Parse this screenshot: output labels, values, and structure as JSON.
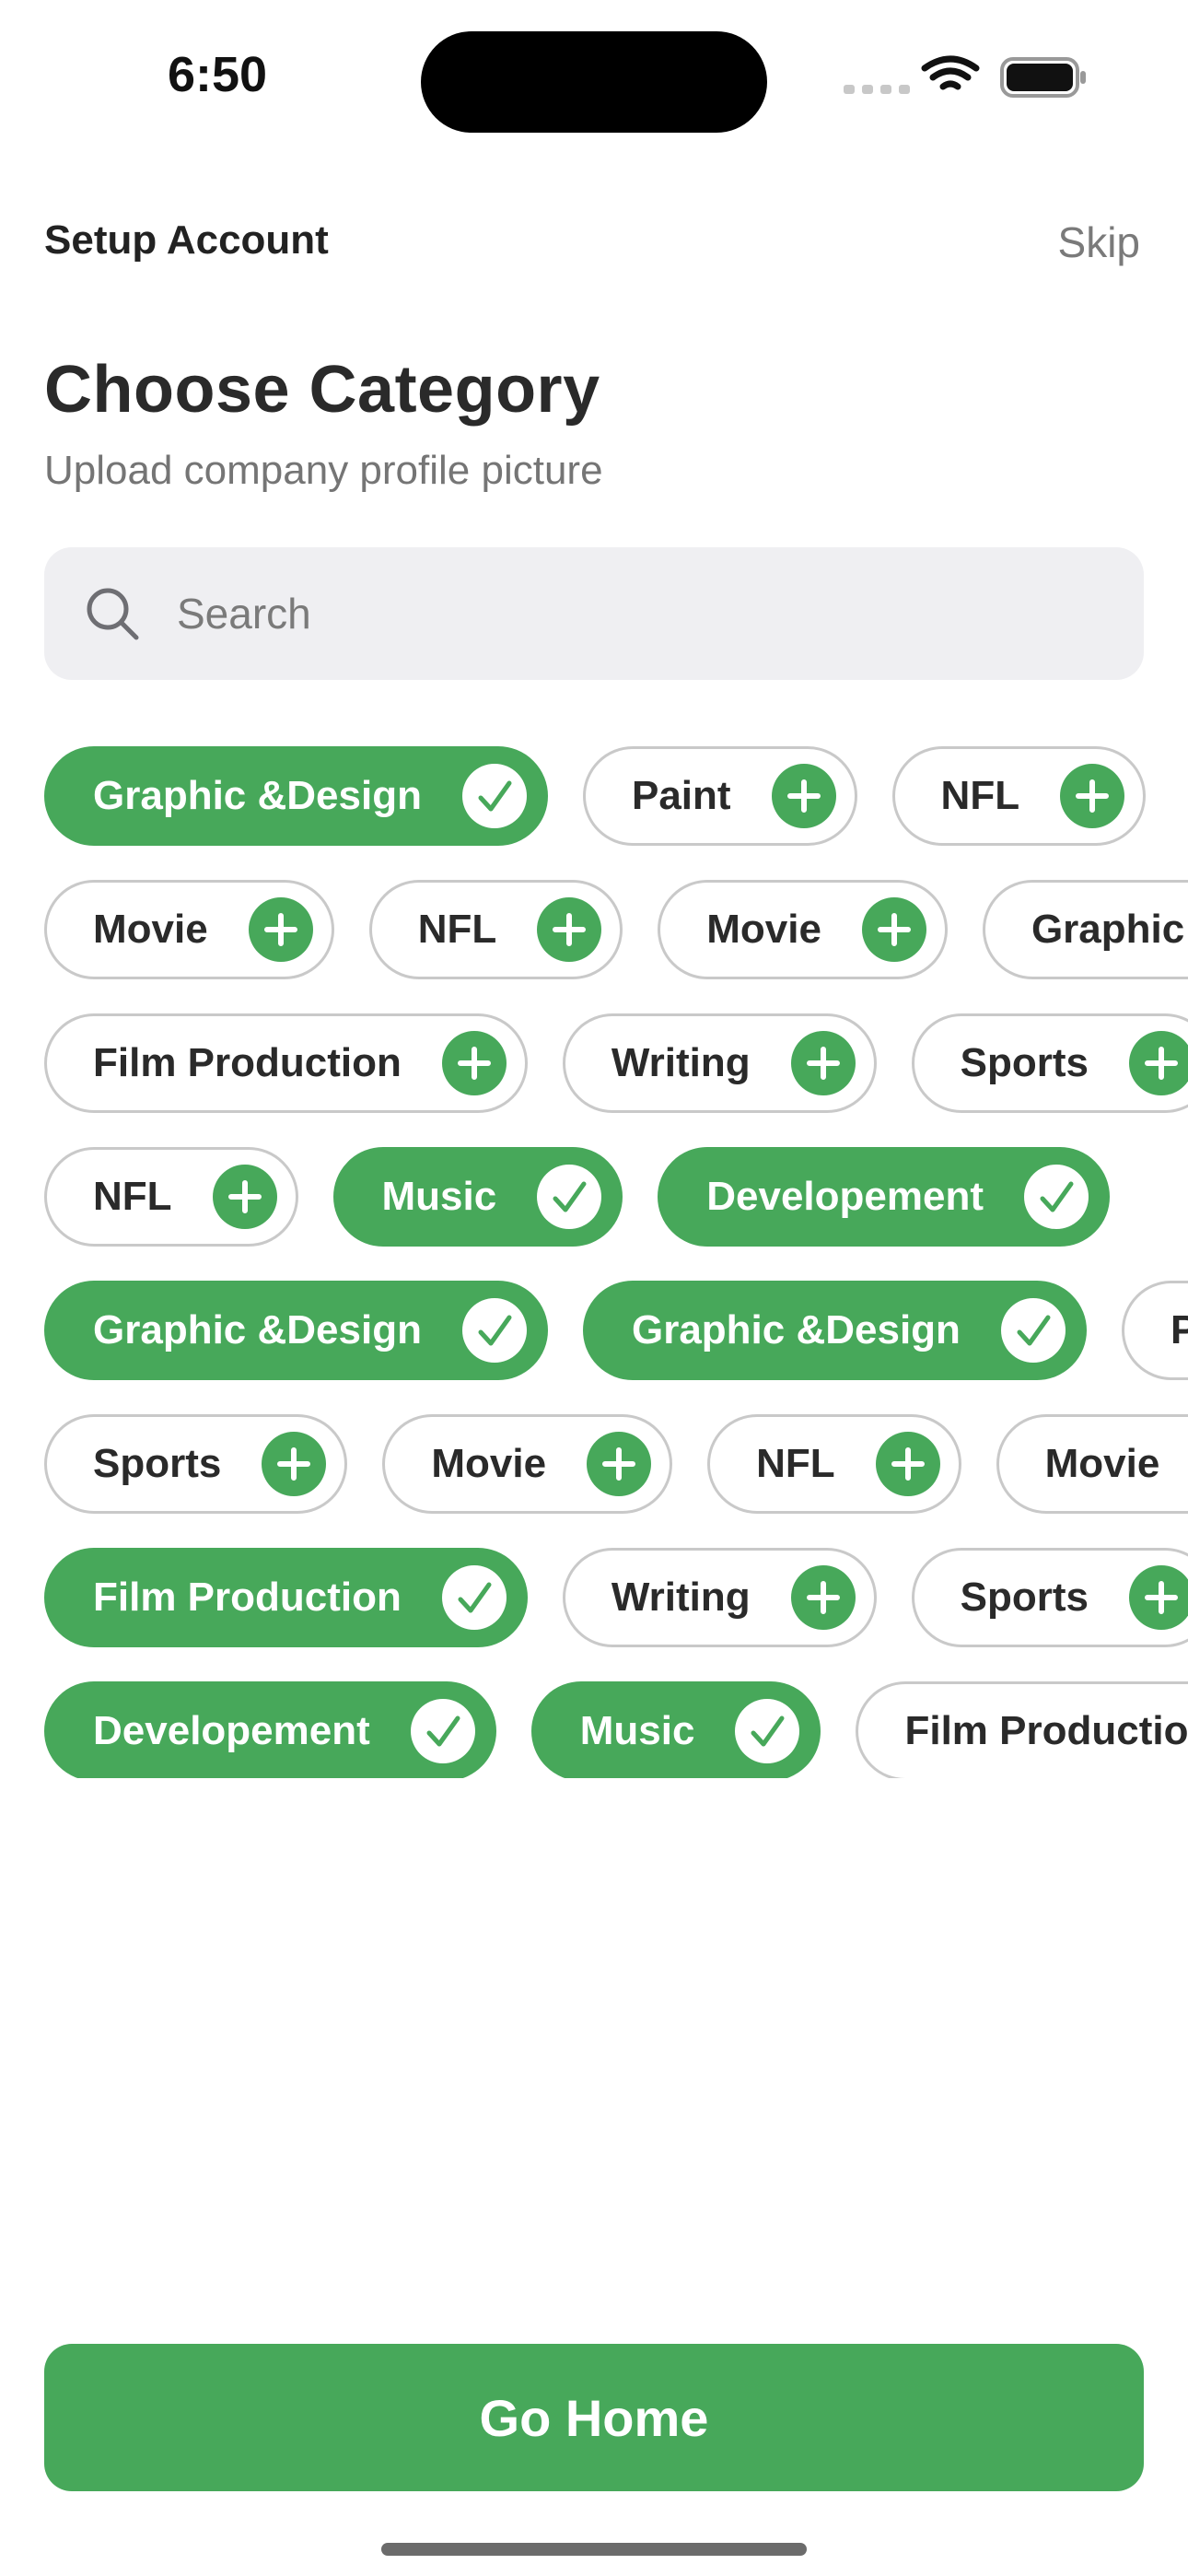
{
  "status_bar": {
    "time": "6:50"
  },
  "header": {
    "title": "Setup Account",
    "skip_label": "Skip"
  },
  "main": {
    "title": "Choose Category",
    "subtitle": "Upload company profile picture"
  },
  "search": {
    "placeholder": "Search",
    "value": ""
  },
  "colors": {
    "accent": "#47a85a",
    "chip_border": "#c9c9c9",
    "search_bg": "#efeff2"
  },
  "chip_rows": [
    [
      {
        "label": "Graphic &Design",
        "selected": true
      },
      {
        "label": "Paint",
        "selected": false
      },
      {
        "label": "NFL",
        "selected": false
      }
    ],
    [
      {
        "label": "Movie",
        "selected": false
      },
      {
        "label": "NFL",
        "selected": false
      },
      {
        "label": "Movie",
        "selected": false
      },
      {
        "label": "Graphic &Design",
        "selected": false
      }
    ],
    [
      {
        "label": "Film Production",
        "selected": false
      },
      {
        "label": "Writing",
        "selected": false
      },
      {
        "label": "Sports",
        "selected": false
      }
    ],
    [
      {
        "label": "NFL",
        "selected": false
      },
      {
        "label": "Music",
        "selected": true
      },
      {
        "label": "Developement",
        "selected": true
      }
    ],
    [
      {
        "label": "Graphic &Design",
        "selected": true
      },
      {
        "label": "Graphic &Design",
        "selected": true
      },
      {
        "label": "Paint",
        "selected": false
      }
    ],
    [
      {
        "label": "Sports",
        "selected": false
      },
      {
        "label": "Movie",
        "selected": false
      },
      {
        "label": "NFL",
        "selected": false
      },
      {
        "label": "Movie",
        "selected": false
      }
    ],
    [
      {
        "label": "Film Production",
        "selected": true
      },
      {
        "label": "Writing",
        "selected": false
      },
      {
        "label": "Sports",
        "selected": false
      }
    ],
    [
      {
        "label": "Developement",
        "selected": true
      },
      {
        "label": "Music",
        "selected": true
      },
      {
        "label": "Film Production",
        "selected": false
      }
    ]
  ],
  "icons": {
    "selected": "check-icon",
    "unselected": "plus-icon"
  },
  "footer": {
    "button_label": "Go Home"
  }
}
